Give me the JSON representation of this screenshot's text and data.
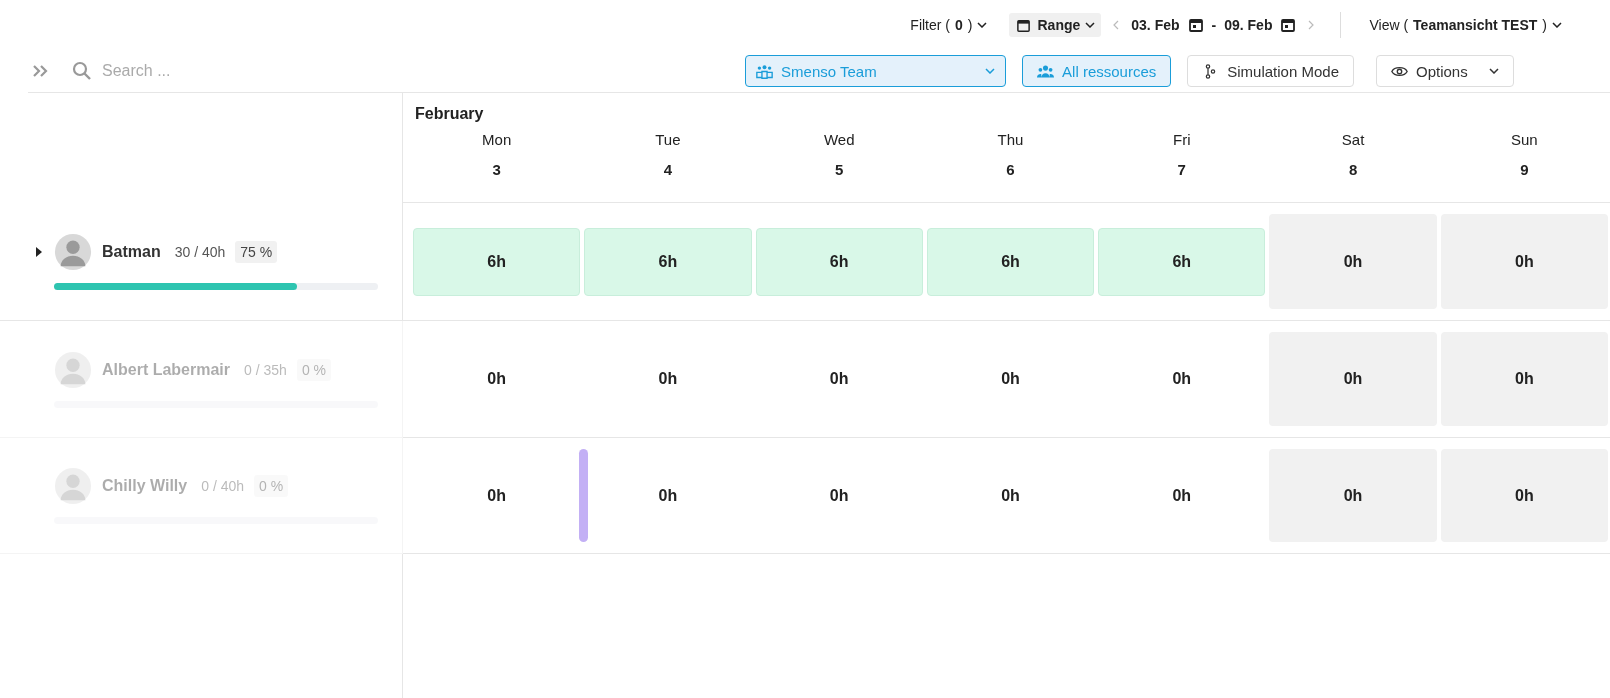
{
  "toolbar": {
    "filter": "Filter (**0**)",
    "range": {
      "label": "Range",
      "selected": true
    },
    "date_from": "03. Feb",
    "separator": "-",
    "date_to": "09. Feb",
    "view": "View (**Teamansicht TEST**)"
  },
  "filters": {
    "search": {
      "placeholder": "Search ..."
    },
    "team": "Smenso Team",
    "resources": {
      "label": "All ressources",
      "selected": true
    },
    "simulation": {
      "label": "Simulation Mode",
      "selected": false
    },
    "options": "Options"
  },
  "calendar": {
    "month": "February",
    "days": [
      {
        "weekday": "Mon",
        "date": "3"
      },
      {
        "weekday": "Tue",
        "date": "4"
      },
      {
        "weekday": "Wed",
        "date": "5"
      },
      {
        "weekday": "Thu",
        "date": "6"
      },
      {
        "weekday": "Fri",
        "date": "7"
      },
      {
        "weekday": "Sat",
        "date": "8"
      },
      {
        "weekday": "Sun",
        "date": "9"
      }
    ]
  },
  "people": [
    {
      "name": "Batman",
      "hours": "30 / 40h",
      "percent": "75 %",
      "level": 0.75,
      "expanded": false,
      "dimmed": false,
      "cells": [
        {
          "kind": "booked",
          "value": "6h"
        },
        {
          "kind": "booked",
          "value": "6h"
        },
        {
          "kind": "booked",
          "value": "6h"
        },
        {
          "kind": "booked",
          "value": "6h"
        },
        {
          "kind": "booked",
          "value": "6h"
        },
        {
          "kind": "weekend",
          "value": "0h"
        },
        {
          "kind": "weekend",
          "value": "0h"
        }
      ]
    },
    {
      "name": "Albert Labermair",
      "hours": "0 / 35h",
      "percent": "0 %",
      "dimmed": true,
      "cells": [
        {
          "kind": "free",
          "value": "0h"
        },
        {
          "kind": "free",
          "value": "0h"
        },
        {
          "kind": "free",
          "value": "0h"
        },
        {
          "kind": "free",
          "value": "0h"
        },
        {
          "kind": "free",
          "value": "0h"
        },
        {
          "kind": "weekend",
          "value": "0h"
        },
        {
          "kind": "weekend",
          "value": "0h"
        }
      ]
    },
    {
      "name": "Chilly Willy",
      "hours": "0 / 40h",
      "percent": "0 %",
      "dimmed": true,
      "marker": true,
      "cells": [
        {
          "kind": "free",
          "value": "0h"
        },
        {
          "kind": "free",
          "value": "0h"
        },
        {
          "kind": "free",
          "value": "0h"
        },
        {
          "kind": "free",
          "value": "0h"
        },
        {
          "kind": "free",
          "value": "0h"
        },
        {
          "kind": "weekend",
          "value": "0h"
        },
        {
          "kind": "weekend",
          "value": "0h"
        }
      ]
    }
  ]
}
